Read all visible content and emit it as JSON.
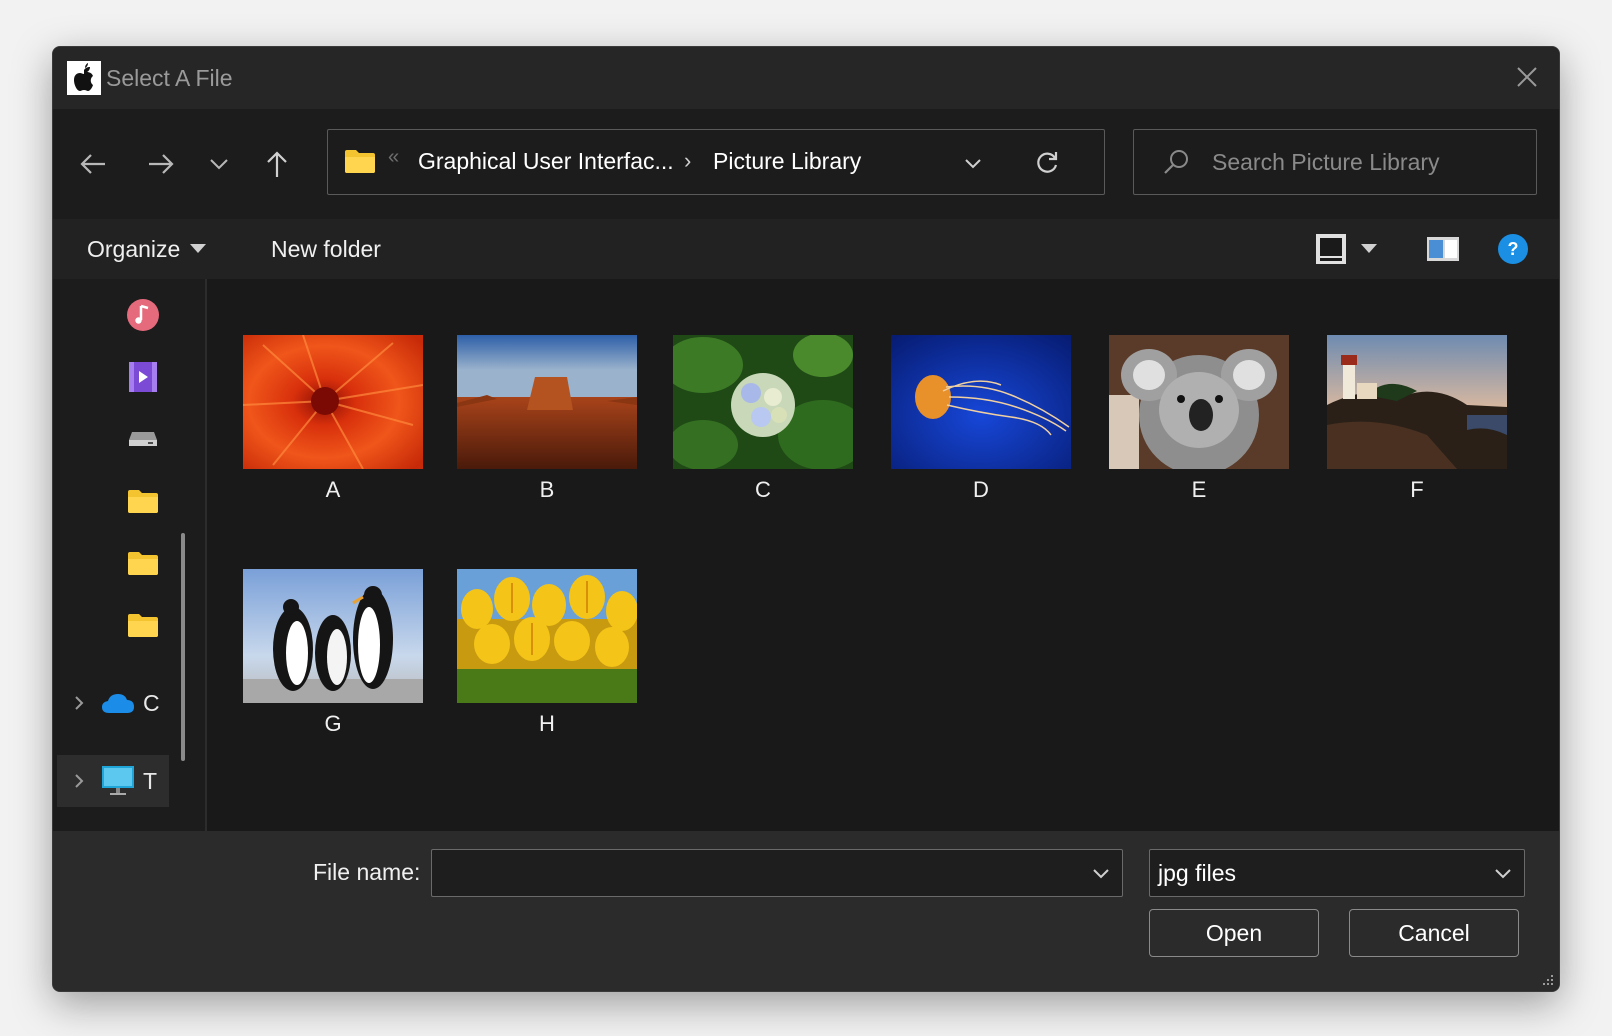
{
  "window": {
    "title": "Select A File",
    "close_icon": "close-icon"
  },
  "nav": {
    "back_icon": "arrow-left-icon",
    "forward_icon": "arrow-right-icon",
    "recent_icon": "chevron-down-icon",
    "up_icon": "arrow-up-icon"
  },
  "address": {
    "overflow_indicator": "«",
    "crumbs": [
      "Graphical User Interfac...",
      "Picture Library"
    ],
    "separator": "›",
    "refresh_icon": "refresh-icon"
  },
  "search": {
    "placeholder": "Search Picture Library",
    "value": ""
  },
  "toolbar": {
    "organize_label": "Organize",
    "new_folder_label": "New folder",
    "help_color": "#1a8fe3"
  },
  "navpane": {
    "items": [
      {
        "icon": "music-icon"
      },
      {
        "icon": "videos-icon"
      },
      {
        "icon": "drive-icon"
      },
      {
        "icon": "folder-icon"
      },
      {
        "icon": "folder-icon"
      },
      {
        "icon": "folder-icon"
      }
    ],
    "tree": [
      {
        "label": "C",
        "icon": "onedrive-cloud-icon",
        "selected": false
      },
      {
        "label": "T",
        "icon": "this-pc-monitor-icon",
        "selected": true
      }
    ]
  },
  "files": [
    {
      "name": "A",
      "subject": "red-flower"
    },
    {
      "name": "B",
      "subject": "desert-mesa"
    },
    {
      "name": "C",
      "subject": "hydrangea"
    },
    {
      "name": "D",
      "subject": "jellyfish"
    },
    {
      "name": "E",
      "subject": "koala"
    },
    {
      "name": "F",
      "subject": "lighthouse"
    },
    {
      "name": "G",
      "subject": "penguins"
    },
    {
      "name": "H",
      "subject": "tulips"
    }
  ],
  "bottom": {
    "file_name_label": "File name:",
    "file_name_value": "",
    "file_type_value": "jpg files",
    "open_label": "Open",
    "cancel_label": "Cancel"
  }
}
